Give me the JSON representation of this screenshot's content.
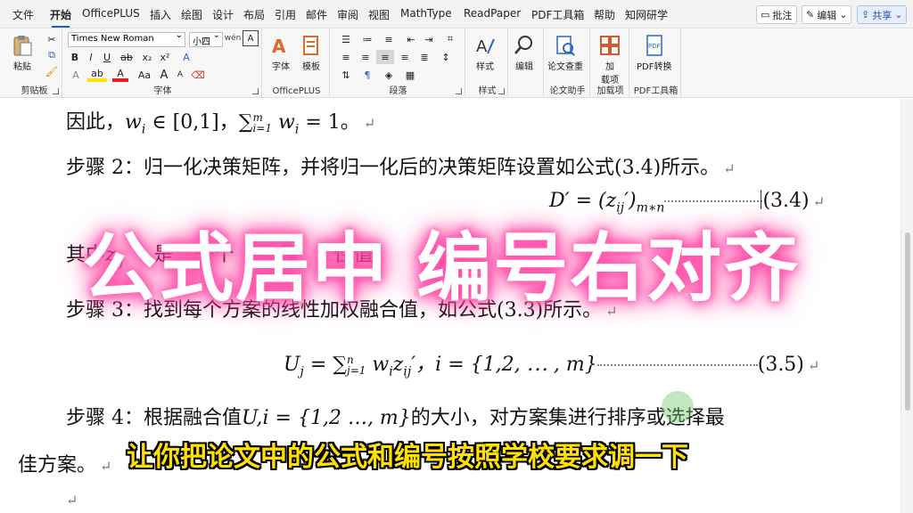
{
  "menu": {
    "tabs": [
      "文件",
      "开始",
      "OfficePLUS",
      "插入",
      "绘图",
      "设计",
      "布局",
      "引用",
      "邮件",
      "审阅",
      "视图",
      "MathType",
      "ReadPaper",
      "PDF工具箱",
      "帮助",
      "知网研学"
    ],
    "active_tab": "开始",
    "comment_button": "批注",
    "edit_button": "编辑",
    "share_button": "共享"
  },
  "ribbon": {
    "clipboard": {
      "paste": "粘贴",
      "label": "剪贴板"
    },
    "font": {
      "name": "Times New Roman",
      "size": "小四",
      "label": "字体",
      "bold": "B",
      "italic": "I",
      "underline": "U",
      "strike": "ab",
      "sub": "x₂",
      "sup": "x²",
      "clear": "A",
      "highlight": "ab",
      "color": "A",
      "aa": "Aa",
      "grow": "A",
      "shrink": "A",
      "wen": "wén",
      "a_box": "A"
    },
    "officeplus": {
      "font_btn": "字体",
      "template_btn": "模板",
      "label": "OfficePLUS"
    },
    "paragraph": {
      "label": "段落"
    },
    "styles": {
      "button": "样式",
      "label": "样式"
    },
    "editing": {
      "button": "编辑"
    },
    "thesis": {
      "check": "论文查重",
      "label": "论文助手"
    },
    "addins": {
      "button_line1": "加",
      "button_line2": "载项",
      "label": "加载项"
    },
    "pdf": {
      "button": "PDF转换",
      "label": "PDF工具箱"
    }
  },
  "document": {
    "line1_prefix": "因此，",
    "line1_math": "w",
    "line1_sub": "i",
    "line1_rest": " ∈ [0,1]，∑",
    "line1_sum_top": "m",
    "line1_sum_bot": "i=1",
    "line1_tail": " w",
    "line1_tail_sub": "i",
    "line1_end": " = 1。",
    "line2": "步骤 2：归一化决策矩阵，并将归一化后的决策矩阵设置如公式(3.4)所示。",
    "eq34_lhs": "D′ = (z",
    "eq34_sub": "ij",
    "eq34_rhs": "′)",
    "eq34_msub": "m∗n",
    "eq34_num": "(3.4)",
    "line4_visible": "其中",
    "line4_a": "z",
    "line4_b": "ij",
    "line4_c": "是",
    "line4_d": "一个",
    "line4_e": "属",
    "line4_f": "性值",
    "line5": "步骤 3：找到每个方案的线性加权融合值，如公式(3.3)所示。",
    "eq35_a": "U",
    "eq35_asub": "j",
    "eq35_b": " = ∑",
    "eq35_top": "n",
    "eq35_bot": "j=1",
    "eq35_c": " w",
    "eq35_csub": "i",
    "eq35_d": "z",
    "eq35_dsub": "ij",
    "eq35_e": "′，i = {1,2, ⋯ , m}",
    "eq35_num": "(3.5)",
    "line7": "步骤 4：根据融合值",
    "line7_math": "U,i = {1,2 …, m}",
    "line7_rest": "的大小，对方案集进行排序或选择最",
    "line8": "佳方案。",
    "return_mark": "↵"
  },
  "overlay": {
    "banner": "公式居中 编号右对齐",
    "subtitle": "让你把论文中的公式和编号按照学校要求调一下"
  }
}
